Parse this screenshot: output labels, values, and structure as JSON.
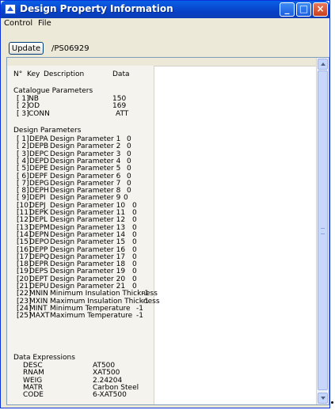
{
  "window": {
    "title": "Design Property Information"
  },
  "menu": [
    "Control",
    "File"
  ],
  "toolbar": {
    "update_label": "Update",
    "path": "/PS06929"
  },
  "columns": [
    "N°",
    "Key",
    "Description",
    "Data"
  ],
  "sections": {
    "catalogue": "Catalogue Parameters",
    "design": "Design Parameters",
    "expressions": "Data Expressions"
  },
  "catalogue_params": [
    {
      "id": "[ 1]",
      "key": "NB",
      "desc": "",
      "data": "150"
    },
    {
      "id": "[ 2]",
      "key": "OD",
      "desc": "",
      "data": "169"
    },
    {
      "id": "[ 3]",
      "key": "CONN",
      "desc": "",
      "data": "ATT"
    }
  ],
  "design_params": [
    {
      "id": "[ 1]",
      "key": "DEPA",
      "desc": "Design Parameter 1",
      "data": "0"
    },
    {
      "id": "[ 2]",
      "key": "DEPB",
      "desc": "Design Parameter 2",
      "data": "0"
    },
    {
      "id": "[ 3]",
      "key": "DEPC",
      "desc": "Design Parameter 3",
      "data": "0"
    },
    {
      "id": "[ 4]",
      "key": "DEPD",
      "desc": "Design Parameter 4",
      "data": "0"
    },
    {
      "id": "[ 5]",
      "key": "DEPE",
      "desc": "Design Parameter 5",
      "data": "0"
    },
    {
      "id": "[ 6]",
      "key": "DEPF",
      "desc": "Design Parameter 6",
      "data": "0"
    },
    {
      "id": "[ 7]",
      "key": "DEPG",
      "desc": "Design Parameter 7",
      "data": "0"
    },
    {
      "id": "[ 8]",
      "key": "DEPH",
      "desc": "Design Parameter 8",
      "data": "0"
    },
    {
      "id": "[ 9]",
      "key": "DEPI",
      "desc": "Design Parameter 9",
      "data": "0"
    },
    {
      "id": "[10]",
      "key": "DEPJ",
      "desc": "Design Parameter 10",
      "data": "0"
    },
    {
      "id": "[11]",
      "key": "DEPK",
      "desc": "Design Parameter 11",
      "data": "0"
    },
    {
      "id": "[12]",
      "key": "DEPL",
      "desc": "Design Parameter 12",
      "data": "0"
    },
    {
      "id": "[13]",
      "key": "DEPM",
      "desc": "Design Parameter 13",
      "data": "0"
    },
    {
      "id": "[14]",
      "key": "DEPN",
      "desc": "Design Parameter 14",
      "data": "0"
    },
    {
      "id": "[15]",
      "key": "DEPO",
      "desc": "Design Parameter 15",
      "data": "0"
    },
    {
      "id": "[16]",
      "key": "DEPP",
      "desc": "Design Parameter 16",
      "data": "0"
    },
    {
      "id": "[17]",
      "key": "DEPQ",
      "desc": "Design Parameter 17",
      "data": "0"
    },
    {
      "id": "[18]",
      "key": "DEPR",
      "desc": "Design Parameter 18",
      "data": "0"
    },
    {
      "id": "[19]",
      "key": "DEPS",
      "desc": "Design Parameter 19",
      "data": "0"
    },
    {
      "id": "[20]",
      "key": "DEPT",
      "desc": "Design Parameter 20",
      "data": "0"
    },
    {
      "id": "[21]",
      "key": "DEPU",
      "desc": "Design Parameter 21",
      "data": "0"
    },
    {
      "id": "[22]",
      "key": "MNIN",
      "desc": "Minimum Insulation Thickness",
      "data": "-1"
    },
    {
      "id": "[23]",
      "key": "MXIN",
      "desc": "Maximum Insulation Thickness",
      "data": "-1"
    },
    {
      "id": "[24]",
      "key": "MINT",
      "desc": "Minimum Temperature",
      "data": "-1"
    },
    {
      "id": "[25]",
      "key": "MAXT",
      "desc": "Maximum Temperature",
      "data": "-1"
    }
  ],
  "expressions": [
    {
      "key": "DESC",
      "data": "AT500"
    },
    {
      "key": "RNAM",
      "data": "XAT500"
    },
    {
      "key": "WEIG",
      "data": "2.24204"
    },
    {
      "key": "MATR",
      "data": "Carbon Steel"
    },
    {
      "key": "CODE",
      "data": "6-XAT500"
    }
  ]
}
